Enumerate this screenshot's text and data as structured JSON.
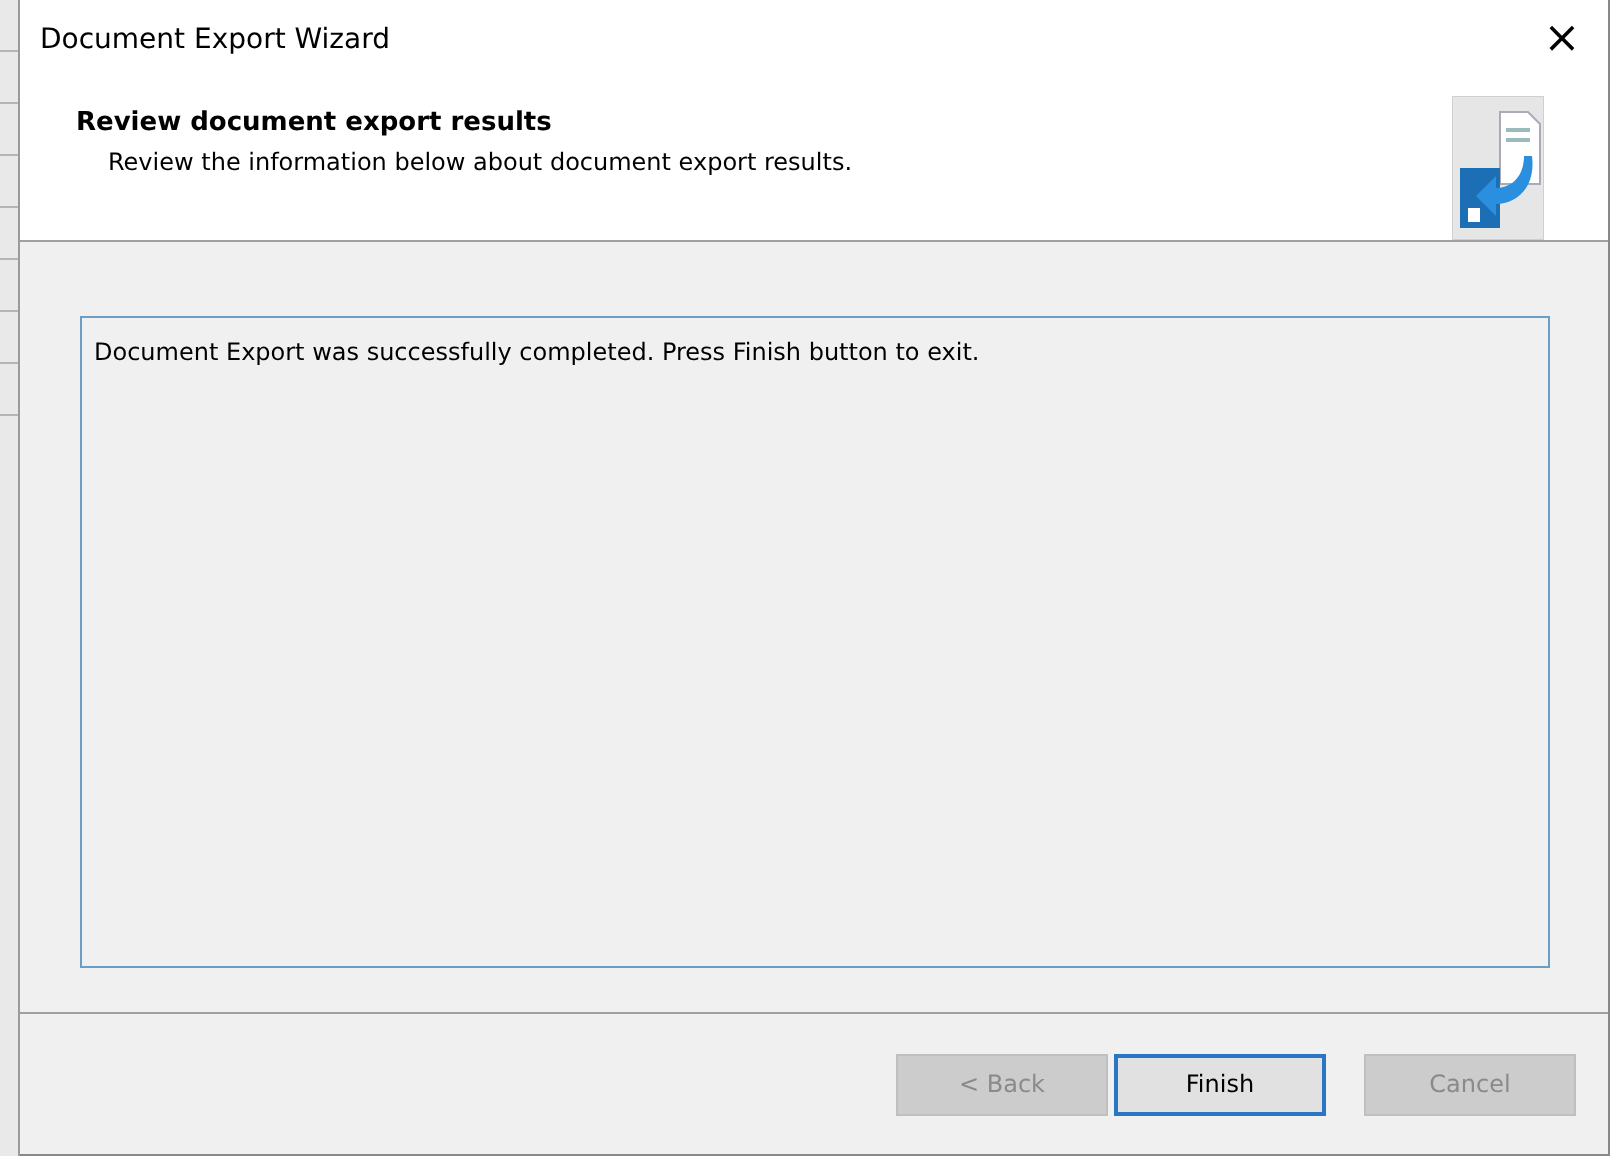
{
  "window": {
    "title": "Document Export Wizard",
    "close": "×"
  },
  "header": {
    "title": "Review document export results",
    "subtitle": "Review the information below about document export results."
  },
  "results": {
    "text": "Document Export was successfully completed. Press Finish button to exit."
  },
  "buttons": [
    {
      "label": "< Back",
      "disabled": true,
      "default": false
    },
    {
      "label": "Finish",
      "disabled": false,
      "default": true
    },
    {
      "label": "Cancel",
      "disabled": true,
      "default": false
    }
  ]
}
